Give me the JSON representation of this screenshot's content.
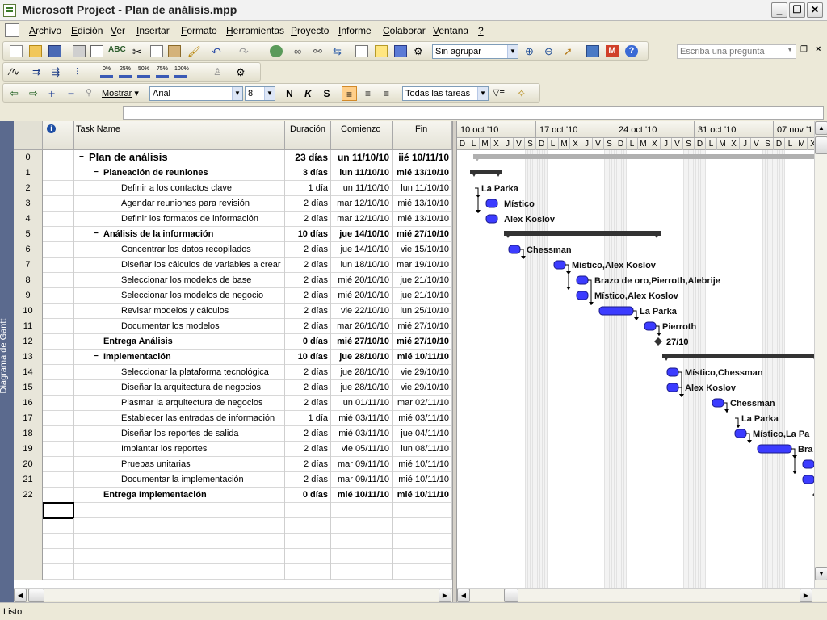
{
  "window": {
    "title": "Microsoft Project - Plan de análisis.mpp"
  },
  "menu": {
    "items": [
      "Archivo",
      "Edición",
      "Ver",
      "Insertar",
      "Formato",
      "Herramientas",
      "Proyecto",
      "Informe",
      "Colaborar",
      "Ventana",
      "?"
    ],
    "ask": "Escriba una pregunta"
  },
  "toolbar": {
    "group_combo": "Sin agrupar",
    "show_label": "Mostrar",
    "font": "Arial",
    "font_size": "8",
    "bold": "N",
    "italic": "K",
    "underline": "S",
    "filter": "Todas las tareas",
    "zoom_labels": [
      "0%",
      "25%",
      "50%",
      "75%",
      "100%"
    ]
  },
  "sidebar": {
    "view_name": "Diagrama de Gantt"
  },
  "table": {
    "columns": {
      "info": "i",
      "task": "Task Name",
      "duration": "Duración",
      "start": "Comienzo",
      "finish": "Fin"
    },
    "rows": [
      {
        "id": "0",
        "name": "Plan de análisis",
        "dur": "23 días",
        "start": "un 11/10/10",
        "finish": "iié 10/11/10",
        "level": 0,
        "summary": true,
        "big": true
      },
      {
        "id": "1",
        "name": "Planeación de reuniones",
        "dur": "3 días",
        "start": "lun 11/10/10",
        "finish": "mié 13/10/10",
        "level": 1,
        "summary": true
      },
      {
        "id": "2",
        "name": "Definir a los contactos clave",
        "dur": "1 día",
        "start": "lun 11/10/10",
        "finish": "lun 11/10/10",
        "level": 2
      },
      {
        "id": "3",
        "name": "Agendar reuniones para revisión",
        "dur": "2 días",
        "start": "mar 12/10/10",
        "finish": "mié 13/10/10",
        "level": 2
      },
      {
        "id": "4",
        "name": "Definir los formatos de información",
        "dur": "2 días",
        "start": "mar 12/10/10",
        "finish": "mié 13/10/10",
        "level": 2
      },
      {
        "id": "5",
        "name": "Análisis de la información",
        "dur": "10 días",
        "start": "jue 14/10/10",
        "finish": "mié 27/10/10",
        "level": 1,
        "summary": true
      },
      {
        "id": "6",
        "name": "Concentrar los datos recopilados",
        "dur": "2 días",
        "start": "jue 14/10/10",
        "finish": "vie 15/10/10",
        "level": 2
      },
      {
        "id": "7",
        "name": "Diseñar los cálculos de variables a crear",
        "dur": "2 días",
        "start": "lun 18/10/10",
        "finish": "mar 19/10/10",
        "level": 2
      },
      {
        "id": "8",
        "name": "Seleccionar los modelos de base",
        "dur": "2 días",
        "start": "mié 20/10/10",
        "finish": "jue 21/10/10",
        "level": 2
      },
      {
        "id": "9",
        "name": "Seleccionar los modelos de negocio",
        "dur": "2 días",
        "start": "mié 20/10/10",
        "finish": "jue 21/10/10",
        "level": 2
      },
      {
        "id": "10",
        "name": "Revisar modelos y cálculos",
        "dur": "2 días",
        "start": "vie 22/10/10",
        "finish": "lun 25/10/10",
        "level": 2
      },
      {
        "id": "11",
        "name": "Documentar los modelos",
        "dur": "2 días",
        "start": "mar 26/10/10",
        "finish": "mié 27/10/10",
        "level": 2
      },
      {
        "id": "12",
        "name": "Entrega Análisis",
        "dur": "0 días",
        "start": "mié 27/10/10",
        "finish": "mié 27/10/10",
        "level": 1,
        "summary": true,
        "nocollapse": true
      },
      {
        "id": "13",
        "name": "Implementación",
        "dur": "10 días",
        "start": "jue 28/10/10",
        "finish": "mié 10/11/10",
        "level": 1,
        "summary": true
      },
      {
        "id": "14",
        "name": "Seleccionar la plataforma tecnológica",
        "dur": "2 días",
        "start": "jue 28/10/10",
        "finish": "vie 29/10/10",
        "level": 2
      },
      {
        "id": "15",
        "name": "Diseñar la arquitectura de negocios",
        "dur": "2 días",
        "start": "jue 28/10/10",
        "finish": "vie 29/10/10",
        "level": 2
      },
      {
        "id": "16",
        "name": "Plasmar la arquitectura de negocios",
        "dur": "2 días",
        "start": "lun 01/11/10",
        "finish": "mar 02/11/10",
        "level": 2
      },
      {
        "id": "17",
        "name": "Establecer las entradas de información",
        "dur": "1 día",
        "start": "mié 03/11/10",
        "finish": "mié 03/11/10",
        "level": 2
      },
      {
        "id": "18",
        "name": "Diseñar los reportes de salida",
        "dur": "2 días",
        "start": "mié 03/11/10",
        "finish": "jue 04/11/10",
        "level": 2
      },
      {
        "id": "19",
        "name": "Implantar los reportes",
        "dur": "2 días",
        "start": "vie 05/11/10",
        "finish": "lun 08/11/10",
        "level": 2
      },
      {
        "id": "20",
        "name": "Pruebas unitarias",
        "dur": "2 días",
        "start": "mar 09/11/10",
        "finish": "mié 10/11/10",
        "level": 2
      },
      {
        "id": "21",
        "name": "Documentar la implementación",
        "dur": "2 días",
        "start": "mar 09/11/10",
        "finish": "mié 10/11/10",
        "level": 2
      },
      {
        "id": "22",
        "name": "Entrega Implementación",
        "dur": "0 días",
        "start": "mié 10/11/10",
        "finish": "mié 10/11/10",
        "level": 1,
        "summary": true,
        "nocollapse": true
      }
    ]
  },
  "gantt": {
    "weeks": [
      "10 oct '10",
      "17 oct '10",
      "24 oct '10",
      "31 oct '10",
      "07 nov '1"
    ],
    "day_letters": [
      "D",
      "L",
      "M",
      "X",
      "J",
      "V",
      "S"
    ],
    "milestone_label": "27/10",
    "resources": {
      "2": "La Parka",
      "3": "Místico",
      "4": "Alex Koslov",
      "6": "Chessman",
      "7": "Místico,Alex Koslov",
      "8": "Brazo de oro,Pierroth,Alebrije",
      "9": "Místico,Alex Koslov",
      "10": "La Parka",
      "11": "Pierroth",
      "14": "Místico,Chessman",
      "15": "Alex Koslov",
      "16": "Chessman",
      "17": "La Parka",
      "18": "Místico,La Pa",
      "19": "Bra"
    },
    "bar_color": "#3c3cff"
  },
  "status": {
    "text": "Listo"
  }
}
